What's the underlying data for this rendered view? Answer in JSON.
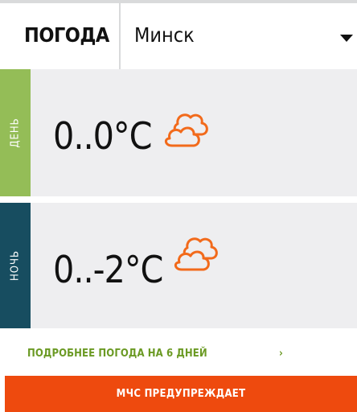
{
  "header": {
    "brand": "ПОГОДА",
    "city": "Минск"
  },
  "day": {
    "label": "ДЕНЬ",
    "temperature": "0..0°C",
    "icon": "cloudy-icon"
  },
  "night": {
    "label": "НОЧЬ",
    "temperature": "0..-2°C",
    "icon": "cloudy-icon"
  },
  "more_link": {
    "label": "ПОДРОБНЕЕ ПОГОДА НА 6 ДНЕЙ",
    "arrow": "›"
  },
  "alert": {
    "label": "МЧС ПРЕДУПРЕЖДАЕТ"
  },
  "colors": {
    "day_tab": "#94bd57",
    "night_tab": "#174d60",
    "icon": "#f26a1b",
    "link": "#6b9a24",
    "alert_bg": "#ee4a0e"
  }
}
